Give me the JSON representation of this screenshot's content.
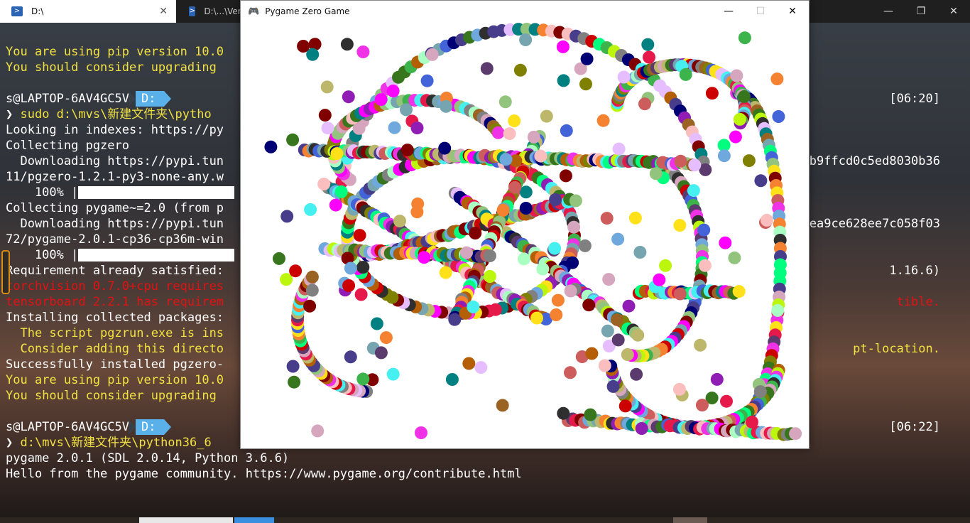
{
  "tabs": [
    {
      "label": "D:\\",
      "active": true
    },
    {
      "label": "D:\\...\\Venu",
      "active": false
    }
  ],
  "window_controls": {
    "minimize": "—",
    "maximize": "❐",
    "close": "✕"
  },
  "terminal": {
    "lines": [
      {
        "text": "You are using pip version 10.0",
        "cls": "y"
      },
      {
        "text": "You should consider upgrading",
        "cls": "y"
      },
      {
        "text": "",
        "cls": ""
      },
      {
        "prompt": true,
        "user": "s@LAPTOP-6AV4GC5V",
        "dir": "D:",
        "time": "[06:20]"
      },
      {
        "text": "❯ sudo d:\\mvs\\新建文件夹\\pytho",
        "cls": "y-cmd"
      },
      {
        "text": "Looking in indexes: https://py",
        "cls": ""
      },
      {
        "text": "Collecting pgzero",
        "cls": ""
      },
      {
        "text": "  Downloading https://pypi.tun",
        "cls": "",
        "right": "b9ffcd0c5ed8030b36"
      },
      {
        "text": "11/pgzero-1.2.1-py3-none-any.w",
        "cls": ""
      },
      {
        "text": "    100% |",
        "cls": "",
        "bar": true
      },
      {
        "text": "Collecting pygame~=2.0 (from p",
        "cls": ""
      },
      {
        "text": "  Downloading https://pypi.tun",
        "cls": "",
        "right": "ea9ce628ee7c058f03"
      },
      {
        "text": "72/pygame-2.0.1-cp36-cp36m-win",
        "cls": ""
      },
      {
        "text": "    100% |",
        "cls": "",
        "bar": true
      },
      {
        "text": "Requirement already satisfied:",
        "cls": "",
        "right": "1.16.6)"
      },
      {
        "text": "torchvision 0.7.0+cpu requires",
        "cls": "r"
      },
      {
        "text": "tensorboard 2.2.1 has requirem",
        "cls": "r",
        "right": "tible."
      },
      {
        "text": "Installing collected packages:",
        "cls": ""
      },
      {
        "text": "  The script pgzrun.exe is ins",
        "cls": "y"
      },
      {
        "text": "  Consider adding this directo",
        "cls": "y",
        "right": "pt-location."
      },
      {
        "text": "Successfully installed pgzero-",
        "cls": ""
      },
      {
        "text": "You are using pip version 10.0",
        "cls": "y"
      },
      {
        "text": "You should consider upgrading",
        "cls": "y"
      },
      {
        "text": "",
        "cls": ""
      },
      {
        "prompt": true,
        "user": "s@LAPTOP-6AV4GC5V",
        "dir": "D:",
        "time": "[06:22]"
      },
      {
        "text": "❯ d:\\mvs\\新建文件夹\\python36_6",
        "cls": "y-cmd2"
      },
      {
        "text": "pygame 2.0.1 (SDL 2.0.14, Python 3.6.6)",
        "cls": ""
      },
      {
        "text": "Hello from the pygame community. https://www.pygame.org/contribute.html",
        "cls": ""
      }
    ]
  },
  "game_window": {
    "title": "Pygame Zero Game",
    "controls": {
      "minimize": "—",
      "maximize": "☐",
      "close": "✕"
    },
    "palette": [
      "#e6194b",
      "#3cb44b",
      "#ffe119",
      "#4363d8",
      "#f58231",
      "#911eb4",
      "#46f0f0",
      "#f032e6",
      "#bcf60c",
      "#fabebe",
      "#008080",
      "#e6beff",
      "#9a6324",
      "#800000",
      "#aaffc3",
      "#808000",
      "#000075",
      "#808080",
      "#2f2f2f",
      "#5b3a6e",
      "#6fa8dc",
      "#b45f06",
      "#38761d",
      "#cc0000",
      "#d5a6bd",
      "#76a5af",
      "#93c47d",
      "#ff00ff",
      "#00ff7f",
      "#483d8b",
      "#bdb76b",
      "#cd5c5c"
    ]
  }
}
